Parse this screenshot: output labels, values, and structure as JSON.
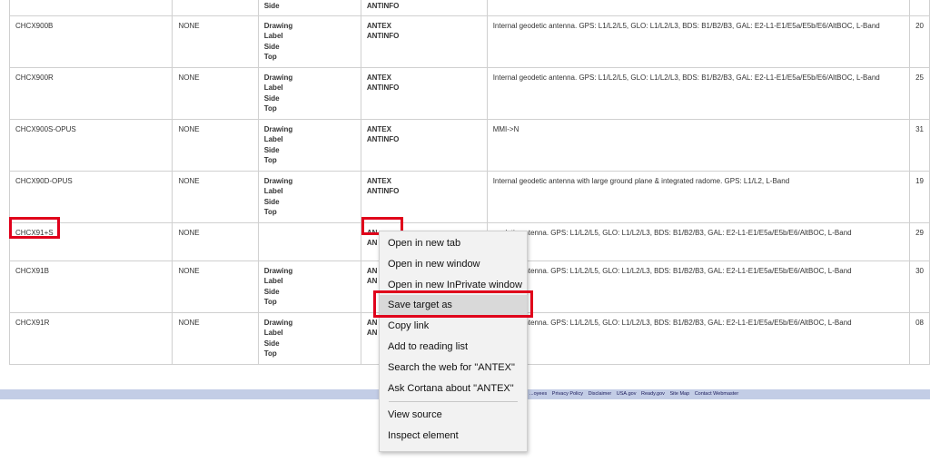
{
  "table": {
    "rows": [
      {
        "name": "",
        "radome": "",
        "links": [
          "Side"
        ],
        "files": [
          "ANTINFO"
        ],
        "desc": "",
        "date": ""
      },
      {
        "name": "CHCX900B",
        "radome": "NONE",
        "links": [
          "Drawing",
          "Label",
          "Side",
          "Top"
        ],
        "files": [
          "ANTEX",
          "ANTINFO"
        ],
        "desc": "Internal geodetic antenna. GPS: L1/L2/L5, GLO: L1/L2/L3, BDS: B1/B2/B3, GAL: E2-L1-E1/E5a/E5b/E6/AltBOC, L-Band",
        "date": "20"
      },
      {
        "name": "CHCX900R",
        "radome": "NONE",
        "links": [
          "Drawing",
          "Label",
          "Side",
          "Top"
        ],
        "files": [
          "ANTEX",
          "ANTINFO"
        ],
        "desc": "Internal geodetic antenna. GPS: L1/L2/L5, GLO: L1/L2/L3, BDS: B1/B2/B3, GAL: E2-L1-E1/E5a/E5b/E6/AltBOC, L-Band",
        "date": "25"
      },
      {
        "name": "CHCX900S-OPUS",
        "radome": "NONE",
        "links": [
          "Drawing",
          "Label",
          "Side",
          "Top"
        ],
        "files": [
          "ANTEX",
          "ANTINFO"
        ],
        "desc": "MMI->N",
        "date": "31"
      },
      {
        "name": "CHCX90D-OPUS",
        "radome": "NONE",
        "links": [
          "Drawing",
          "Label",
          "Side",
          "Top"
        ],
        "files": [
          "ANTEX",
          "ANTINFO"
        ],
        "desc": "Internal geodetic antenna with large ground plane & integrated radome. GPS: L1/L2, L-Band",
        "date": "19"
      },
      {
        "name": "CHCX91+S",
        "radome": "NONE",
        "links": [],
        "files": [
          "AN",
          "AN"
        ],
        "desc": "...odetic antenna. GPS: L1/L2/L5, GLO: L1/L2/L3, BDS: B1/B2/B3, GAL: E2-L1-E1/E5a/E5b/E6/AltBOC, L-Band",
        "date": "29"
      },
      {
        "name": "CHCX91B",
        "radome": "NONE",
        "links": [
          "Drawing",
          "Label",
          "Side",
          "Top"
        ],
        "files": [
          "AN",
          "AN"
        ],
        "desc": "...odetic antenna. GPS: L1/L2/L5, GLO: L1/L2/L3, BDS: B1/B2/B3, GAL: E2-L1-E1/E5a/E5b/E6/AltBOC, L-Band",
        "date": "30"
      },
      {
        "name": "CHCX91R",
        "radome": "NONE",
        "links": [
          "Drawing",
          "Label",
          "Side",
          "Top"
        ],
        "files": [
          "AN",
          "AN"
        ],
        "desc": "...odetic antenna. GPS: L1/L2/L5, GLO: L1/L2/L3, BDS: B1/B2/B3, GAL: E2-L1-E1/E5a/E5b/E6/AltBOC, L-Band",
        "date": "08"
      }
    ]
  },
  "footer": {
    "links": [
      "...oyees",
      "Privacy Policy",
      "Disclaimer",
      "USA.gov",
      "Ready.gov",
      "Site Map",
      "Contact Webmaster"
    ]
  },
  "context_menu": {
    "items": [
      {
        "label": "Open in new tab"
      },
      {
        "label": "Open in new window"
      },
      {
        "label": "Open in new InPrivate window"
      },
      {
        "label": "Save target as"
      },
      {
        "label": "Copy link"
      },
      {
        "label": "Add to reading list"
      },
      {
        "label": "Search the web for \"ANTEX\""
      },
      {
        "label": "Ask Cortana about \"ANTEX\""
      },
      {
        "label": "View source"
      },
      {
        "label": "Inspect element"
      }
    ]
  },
  "colors": {
    "highlight": "#e0001b",
    "link_red": "#8b0000",
    "footer_bg": "#c3cde6"
  }
}
